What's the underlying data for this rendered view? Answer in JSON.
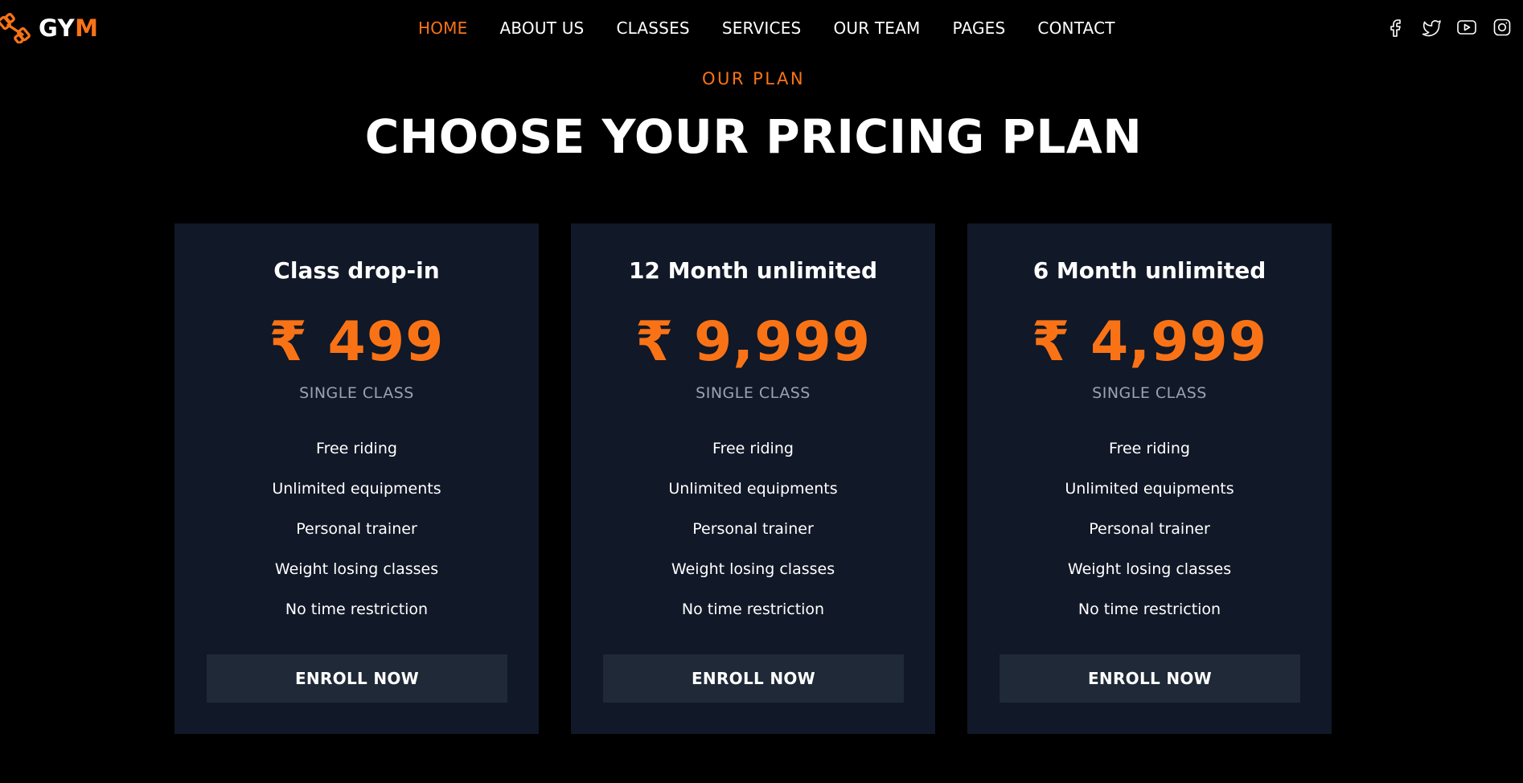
{
  "logo": {
    "text_a": "GY",
    "text_b": "M"
  },
  "nav": {
    "items": [
      {
        "label": "HOME"
      },
      {
        "label": "ABOUT US"
      },
      {
        "label": "CLASSES"
      },
      {
        "label": "SERVICES"
      },
      {
        "label": "OUR TEAM"
      },
      {
        "label": "PAGES"
      },
      {
        "label": "CONTACT"
      }
    ]
  },
  "social": {
    "icons": [
      "facebook-icon",
      "twitter-icon",
      "youtube-icon",
      "instagram-icon"
    ]
  },
  "section": {
    "eyebrow": "OUR PLAN",
    "title": "CHOOSE YOUR PRICING PLAN"
  },
  "plans": [
    {
      "title": "Class drop-in",
      "price": "₹ 499",
      "subtitle": "SINGLE CLASS",
      "features": [
        "Free riding",
        "Unlimited equipments",
        "Personal trainer",
        "Weight losing classes",
        "No time restriction"
      ],
      "button": "ENROLL NOW"
    },
    {
      "title": "12 Month unlimited",
      "price": "₹ 9,999",
      "subtitle": "SINGLE CLASS",
      "features": [
        "Free riding",
        "Unlimited equipments",
        "Personal trainer",
        "Weight losing classes",
        "No time restriction"
      ],
      "button": "ENROLL NOW"
    },
    {
      "title": "6 Month unlimited",
      "price": "₹ 4,999",
      "subtitle": "SINGLE CLASS",
      "features": [
        "Free riding",
        "Unlimited equipments",
        "Personal trainer",
        "Weight losing classes",
        "No time restriction"
      ],
      "button": "ENROLL NOW"
    }
  ],
  "colors": {
    "accent": "#f97316",
    "background": "#000000",
    "card": "#111827",
    "button": "#1f2937",
    "muted": "#9ca3af"
  }
}
